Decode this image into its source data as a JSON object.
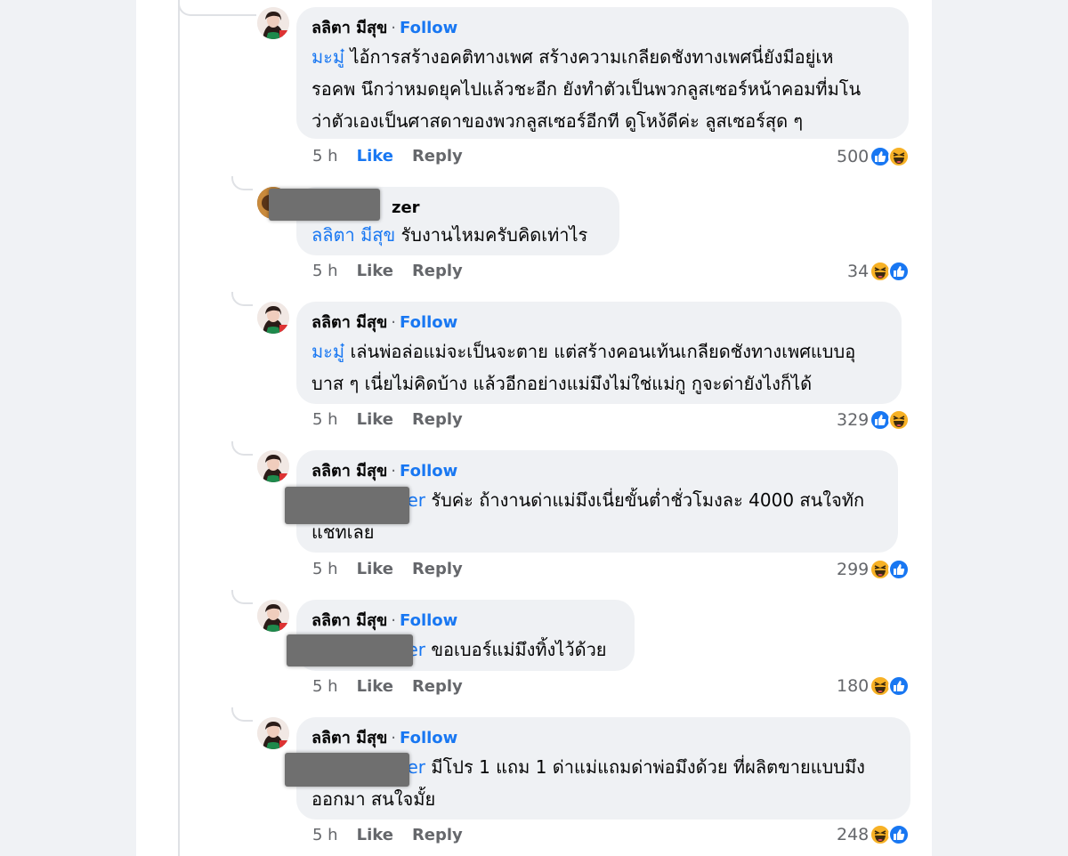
{
  "comments": [
    {
      "author": "ลลิตา มีสุข",
      "separator": "·",
      "follow": "Follow",
      "mention": "มะมู๋",
      "lines": [
        "ไอ้การสร้างอคติทางเพศ สร้างความเกลียดชังทางเพศนี่ยังมีอยู่เห",
        "รอคพ นึกว่าหมดยุคไปแล้วชะอีก ยังทำตัวเป็นพวกลูสเซอร์หน้าคอมที่มโน",
        "ว่าตัวเองเป็นศาสดาของพวกลูสเซอร์อีกที ดูโหง้ดีค่ะ ลูสเซอร์สุด ๆ"
      ],
      "time": "5 h",
      "like": "Like",
      "reply": "Reply",
      "count": "500",
      "reactions": [
        "like-icon",
        "haha-icon"
      ]
    },
    {
      "author_visible": "zer",
      "mention": "ลลิตา มีสุข",
      "lines": [
        "รับงานไหมครับคิดเท่าไร"
      ],
      "time": "5 h",
      "like": "Like",
      "reply": "Reply",
      "count": "34",
      "reactions": [
        "haha-icon",
        "like-icon"
      ]
    },
    {
      "author": "ลลิตา มีสุข",
      "separator": "·",
      "follow": "Follow",
      "mention": "มะมู๋",
      "lines": [
        "เล่นพ่อล่อแม่จะเป็นจะตาย แต่สร้างคอนเท้นเกลียดชังทางเพศแบบอุ",
        "บาส ๆ เนี่ยไม่คิดบ้าง แล้วอีกอย่างแม่มึงไม่ใช่แม่กู กูจะด่ายังไงก็ได้"
      ],
      "time": "5 h",
      "like": "Like",
      "reply": "Reply",
      "count": "329",
      "reactions": [
        "like-icon",
        "haha-icon"
      ]
    },
    {
      "author": "ลลิตา มีสุข",
      "separator": "·",
      "follow": "Follow",
      "mention_visible": "er",
      "lines": [
        "รับค่ะ ถ้างานด่าแม่มึงเนี่ยขั้นต่ำชั่วโมงละ 4000 สนใจทัก",
        "แชทเลย"
      ],
      "time": "5 h",
      "like": "Like",
      "reply": "Reply",
      "count": "299",
      "reactions": [
        "haha-icon",
        "like-icon"
      ]
    },
    {
      "author": "ลลิตา มีสุข",
      "separator": "·",
      "follow": "Follow",
      "mention_visible": "er",
      "lines": [
        "ขอเบอร์แม่มึงทิ้งไว้ด้วย"
      ],
      "time": "5 h",
      "like": "Like",
      "reply": "Reply",
      "count": "180",
      "reactions": [
        "haha-icon",
        "like-icon"
      ]
    },
    {
      "author": "ลลิตา มีสุข",
      "separator": "·",
      "follow": "Follow",
      "mention_visible": "er",
      "lines": [
        "มีโปร 1 แถม 1 ด่าแม่แถมด่าพ่อมึงด้วย ที่ผลิตขายแบบมึง",
        "ออกมา สนใจมั้ย"
      ],
      "time": "5 h",
      "like": "Like",
      "reply": "Reply",
      "count": "248",
      "reactions": [
        "haha-icon",
        "like-icon"
      ]
    }
  ],
  "colors": {
    "link": "#1877f2",
    "bubble": "#eff1f4",
    "muted": "#65676b",
    "like_reaction": "#1877f2",
    "haha_reaction": "#f7b125"
  }
}
